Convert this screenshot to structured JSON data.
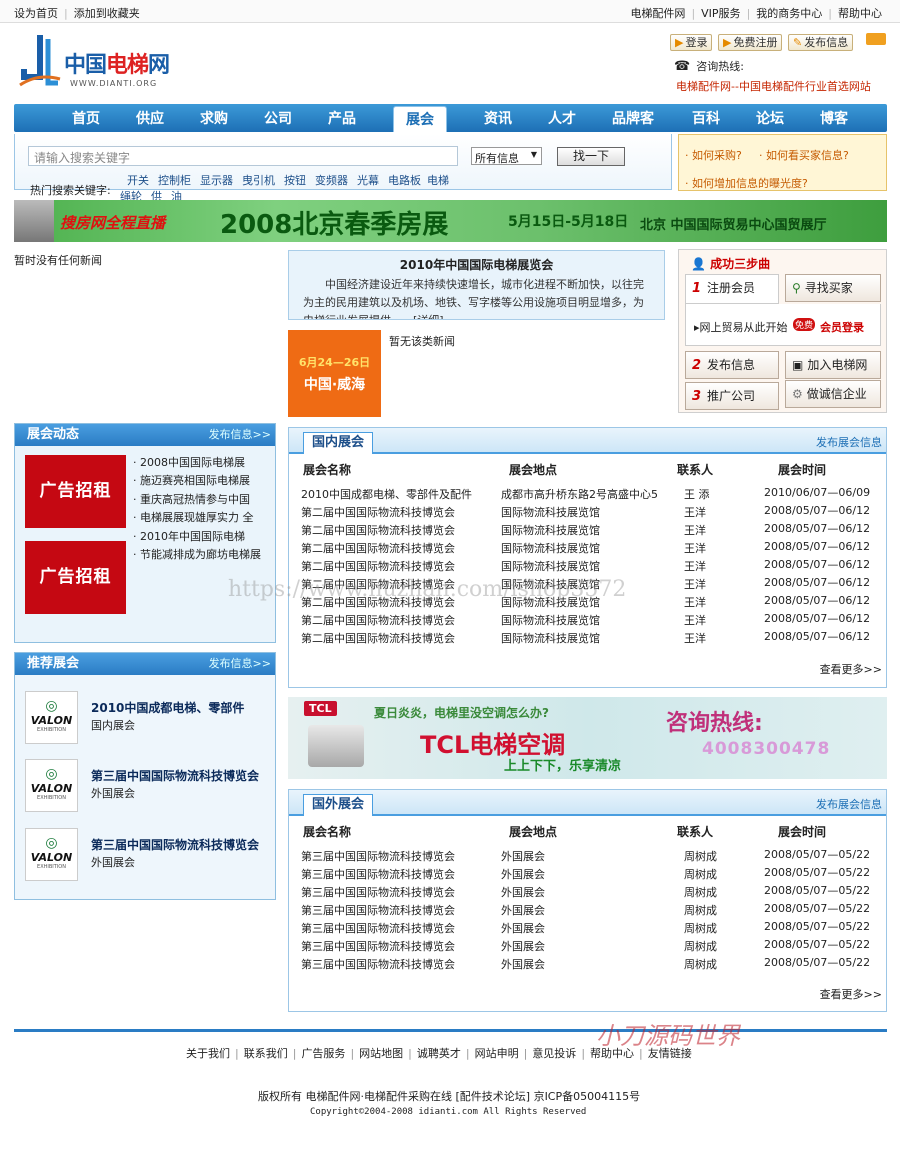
{
  "topbar": {
    "left": [
      "设为首页",
      "添加到收藏夹"
    ],
    "right": [
      "电梯配件网",
      "VIP服务",
      "我的商务中心",
      "帮助中心"
    ]
  },
  "logo": {
    "name_a": "中国",
    "name_b": "电梯",
    "name_c": "网",
    "url": "WWW.DIANTI.ORG"
  },
  "header": {
    "login": "登录",
    "register": "免费注册",
    "publish": "发布信息",
    "hotline_label": "咨询热线:",
    "slogan": "电梯配件网--中国电梯配件行业首选网站"
  },
  "nav": [
    "首页",
    "供应",
    "求购",
    "公司",
    "产品",
    "展会",
    "资讯",
    "人才",
    "品牌客",
    "百科",
    "论坛",
    "博客"
  ],
  "search": {
    "placeholder": "请输入搜索关键字",
    "select": "所有信息",
    "button": "找一下",
    "hot_label": "热门搜索关键字:",
    "hot": [
      "开关",
      "控制柜",
      "显示器",
      "曳引机",
      "按钮",
      "变频器",
      "光幕",
      "电路板",
      "电梯",
      "绳轮",
      "供",
      "油"
    ]
  },
  "help": {
    "q1": "· 如何采购?",
    "q2": "· 如何看买家信息?",
    "q3": "· 如何增加信息的曝光度?"
  },
  "banner": {
    "sohu": "搜房网全程直播",
    "title": "2008北京春季房展",
    "dates": "5月15日-5月18日",
    "venue": "北京 中国国际贸易中心国贸展厅"
  },
  "nonews": "暂时没有任何新闻",
  "expo": {
    "title": "2010年中国国际电梯展览会",
    "text": "中国经济建设近年来持续快速增长，城市化进程不断加快，以往完为主的民用建筑以及机场、地铁、写字楼等公用设施项目明显增多，为电梯行业发展提供……[详细]"
  },
  "weihai": {
    "date": "6月24—26日",
    "city": "中国·威海"
  },
  "nonews2": "暂无该类新闻",
  "steps": {
    "title": "成功三步曲",
    "register": "注册会员",
    "find_buyer": "寻找买家",
    "trade_start": "网上贸易从此开始",
    "free": "免费",
    "member_login": "会员登录",
    "publish": "发布信息",
    "join": "加入电梯网",
    "promote": "推广公司",
    "trust": "做诚信企业"
  },
  "expo_news": {
    "title": "展会动态",
    "more": "发布信息>>",
    "ad": "广告招租",
    "items": [
      "· 2008中国国际电梯展",
      "· 施迈赛亮相国际电梯展",
      "· 重庆高冠热情参与中国",
      "· 电梯展展现雄厚实力 全",
      "· 2010年中国国际电梯",
      "· 节能减排成为廊坊电梯展"
    ]
  },
  "recommend": {
    "title": "推荐展会",
    "more": "发布信息>>",
    "logo_text": "VALON",
    "logo_sub": "EXHIBITION",
    "items": [
      {
        "name": "2010中国成都电梯、零部件",
        "type": "国内展会"
      },
      {
        "name": "第三届中国国际物流科技博览会",
        "type": "外国展会"
      },
      {
        "name": "第三届中国国际物流科技博览会",
        "type": "外国展会"
      }
    ]
  },
  "domestic": {
    "title": "国内展会",
    "more": "发布展会信息",
    "headers": [
      "展会名称",
      "展会地点",
      "联系人",
      "展会时间"
    ],
    "rows": [
      [
        "2010中国成都电梯、零部件及配件",
        "成都市高升桥东路2号高盛中心5",
        "王 添",
        "2010/06/07—06/09"
      ],
      [
        "第二届中国国际物流科技博览会",
        "国际物流科技展览馆",
        "王洋",
        "2008/05/07—06/12"
      ],
      [
        "第二届中国国际物流科技博览会",
        "国际物流科技展览馆",
        "王洋",
        "2008/05/07—06/12"
      ],
      [
        "第二届中国国际物流科技博览会",
        "国际物流科技展览馆",
        "王洋",
        "2008/05/07—06/12"
      ],
      [
        "第二届中国国际物流科技博览会",
        "国际物流科技展览馆",
        "王洋",
        "2008/05/07—06/12"
      ],
      [
        "第二届中国国际物流科技博览会",
        "国际物流科技展览馆",
        "王洋",
        "2008/05/07—06/12"
      ],
      [
        "第二届中国国际物流科技博览会",
        "国际物流科技展览馆",
        "王洋",
        "2008/05/07—06/12"
      ],
      [
        "第二届中国国际物流科技博览会",
        "国际物流科技展览馆",
        "王洋",
        "2008/05/07—06/12"
      ],
      [
        "第二届中国国际物流科技博览会",
        "国际物流科技展览馆",
        "王洋",
        "2008/05/07—06/12"
      ]
    ],
    "view_more": "查看更多>>"
  },
  "tcl": {
    "brand": "TCL",
    "question": "夏日炎炎，电梯里没空调怎么办?",
    "hotline": "咨询热线:",
    "name": "TCL电梯空调",
    "motto": "上上下下，乐享清凉",
    "phone": "4008300478"
  },
  "foreign": {
    "title": "国外展会",
    "more": "发布展会信息",
    "headers": [
      "展会名称",
      "展会地点",
      "联系人",
      "展会时间"
    ],
    "rows": [
      [
        "第三届中国国际物流科技博览会",
        "外国展会",
        "周树成",
        "2008/05/07—05/22"
      ],
      [
        "第三届中国国际物流科技博览会",
        "外国展会",
        "周树成",
        "2008/05/07—05/22"
      ],
      [
        "第三届中国国际物流科技博览会",
        "外国展会",
        "周树成",
        "2008/05/07—05/22"
      ],
      [
        "第三届中国国际物流科技博览会",
        "外国展会",
        "周树成",
        "2008/05/07—05/22"
      ],
      [
        "第三届中国国际物流科技博览会",
        "外国展会",
        "周树成",
        "2008/05/07—05/22"
      ],
      [
        "第三届中国国际物流科技博览会",
        "外国展会",
        "周树成",
        "2008/05/07—05/22"
      ],
      [
        "第三届中国国际物流科技博览会",
        "外国展会",
        "周树成",
        "2008/05/07—05/22"
      ]
    ],
    "view_more": "查看更多>>"
  },
  "footer": {
    "links": [
      "关于我们",
      "联系我们",
      "广告服务",
      "网站地图",
      "诚聘英才",
      "网站申明",
      "意见投诉",
      "帮助中心",
      "友情链接"
    ],
    "copyright": "版权所有 电梯配件网·电梯配件采购在线 [配件技术论坛] 京ICP备05004115号",
    "copyright_en": "Copyright©2004-2008 idianti.com All Rights Reserved"
  },
  "watermark": {
    "url": "https://www.huzhan.com/ishop3572",
    "brand": "小刀源码世界"
  },
  "colors": {
    "nav": "#1d6fb5",
    "accent_red": "#c50812",
    "banner_green": "#4cb04c"
  }
}
